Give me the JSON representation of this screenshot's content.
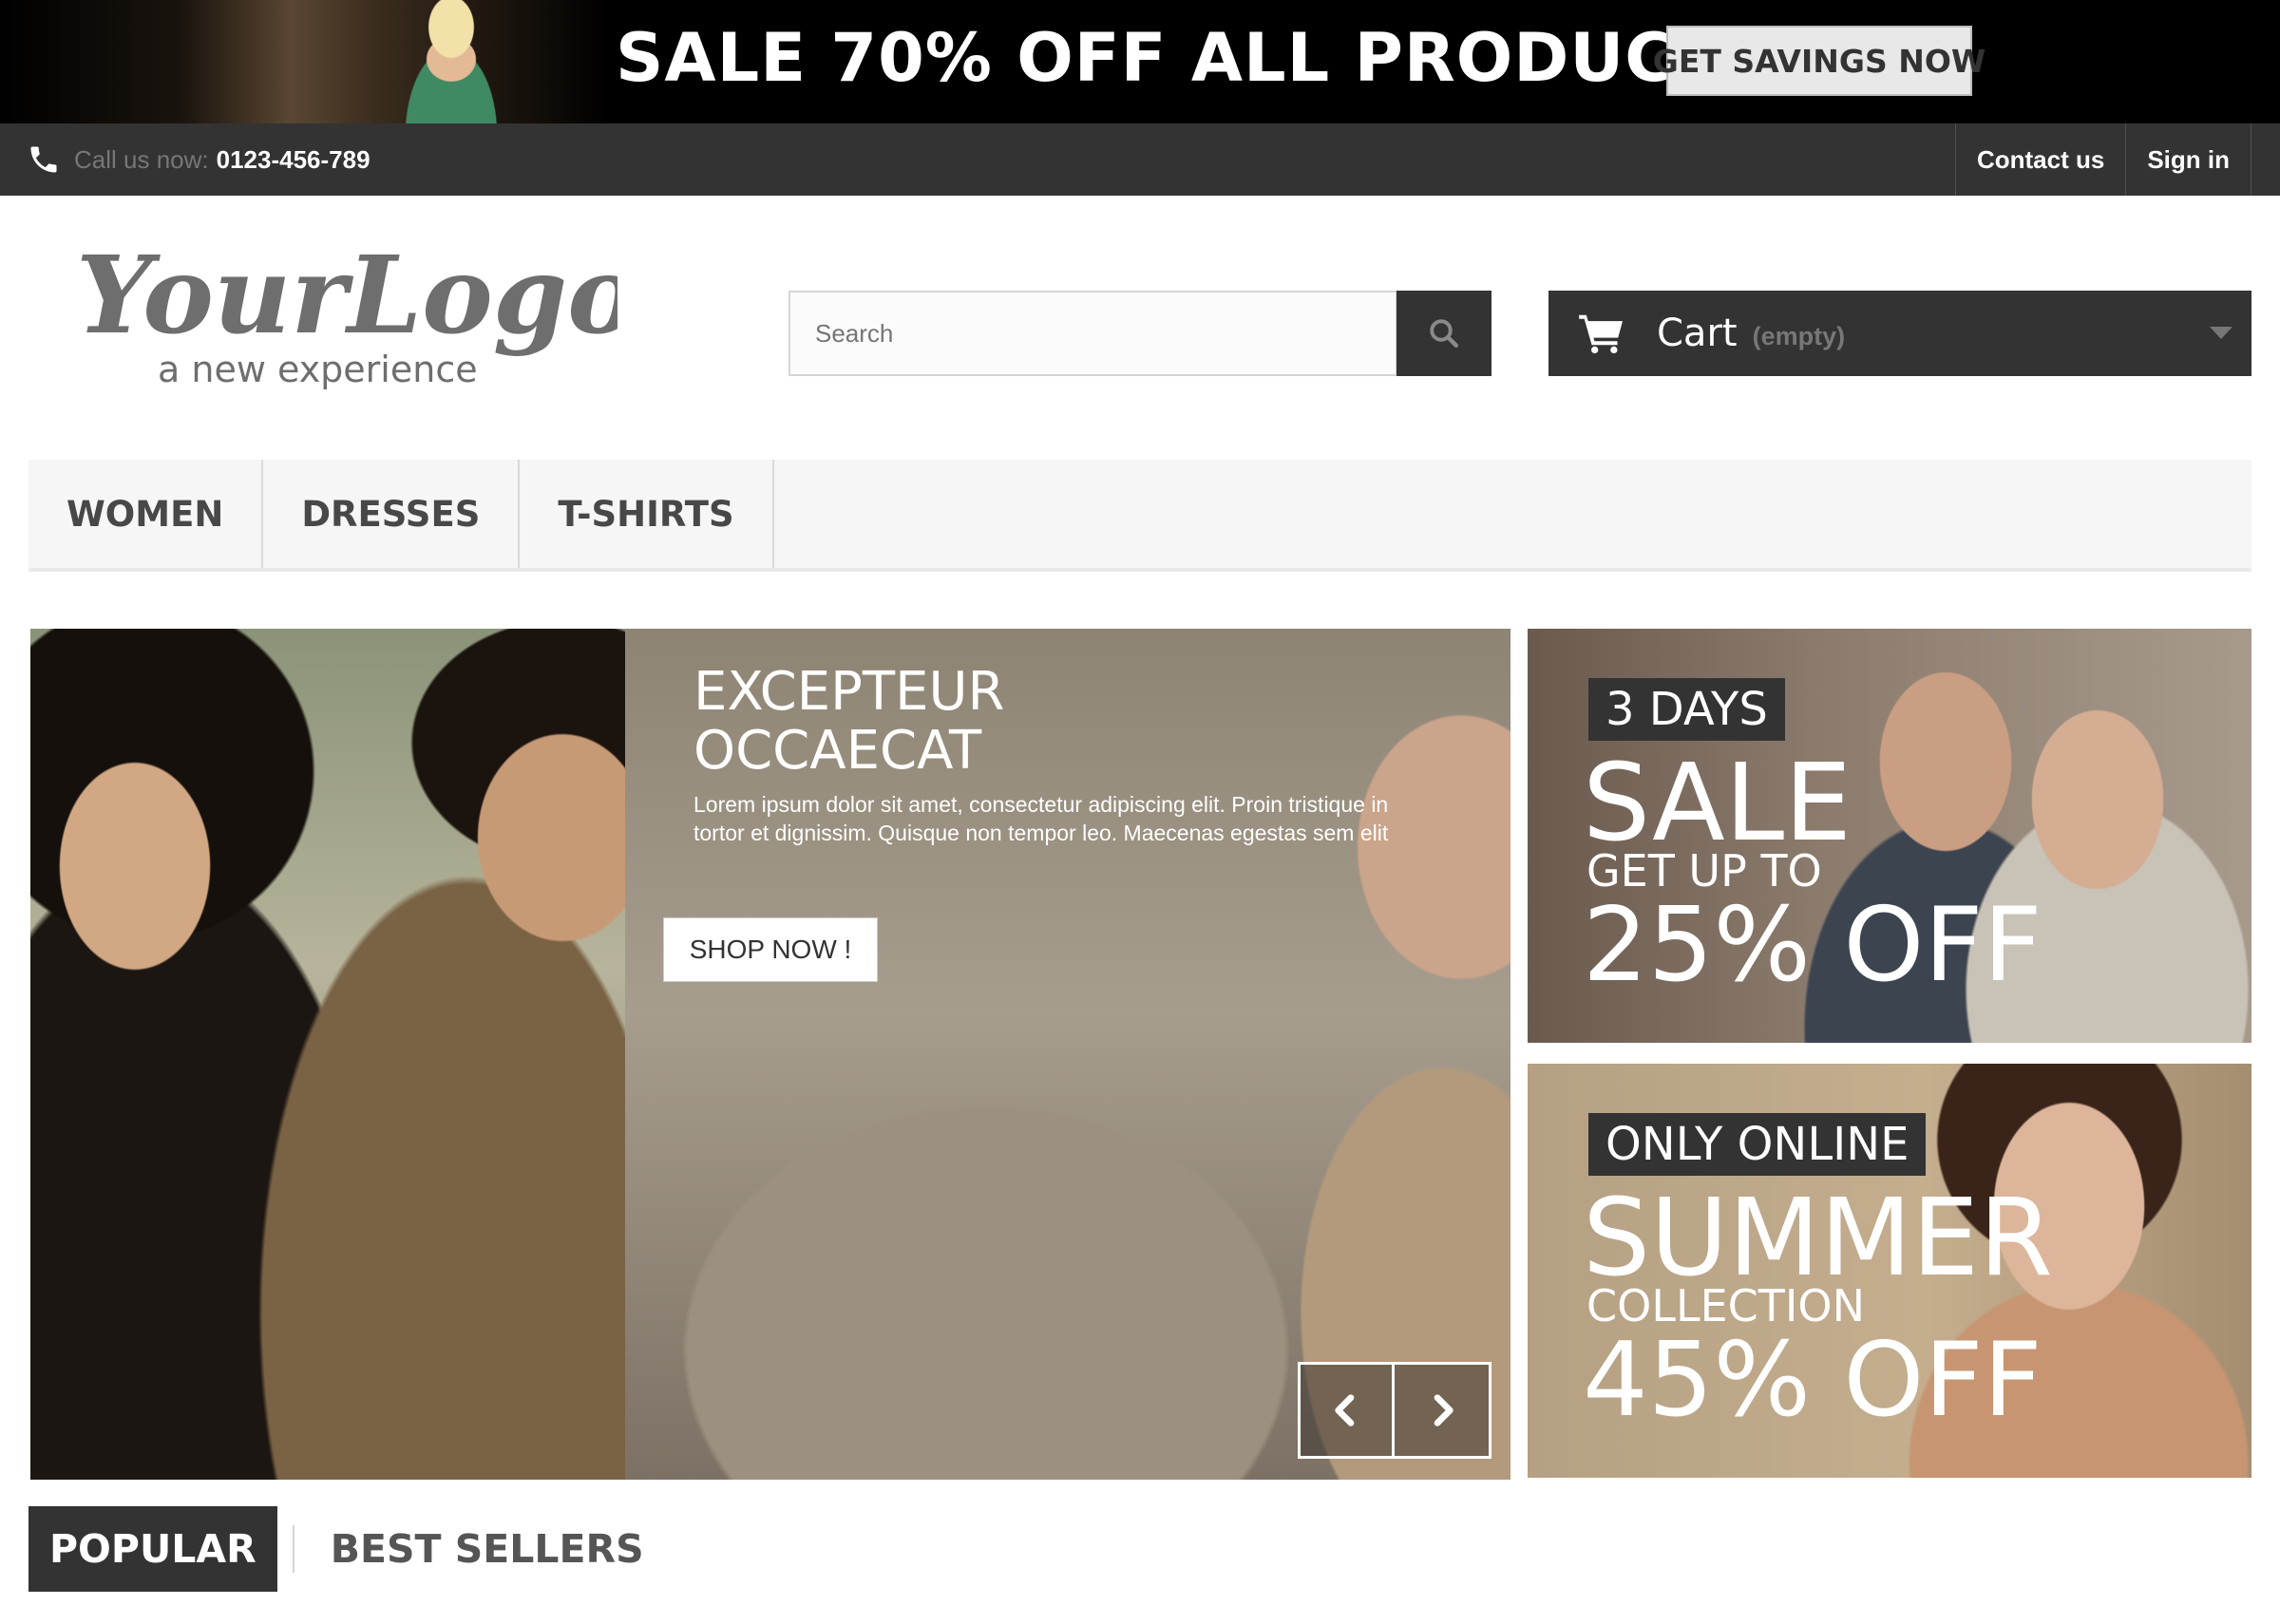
{
  "promo_banner": {
    "headline": "SALE 70% OFF ALL PRODUCTS",
    "button_label": "GET SAVINGS NOW"
  },
  "top_bar": {
    "call_label": "Call us now:",
    "phone_number": "0123-456-789",
    "links": [
      "Contact us",
      "Sign in"
    ]
  },
  "header": {
    "logo_text": "YourLogo",
    "logo_tagline": "a new experience",
    "search_placeholder": "Search",
    "cart_label": "Cart",
    "cart_status": "(empty)"
  },
  "menu": {
    "items": [
      "WOMEN",
      "DRESSES",
      "T-SHIRTS"
    ]
  },
  "slider": {
    "title_line1": "EXCEPTEUR",
    "title_line2": "OCCAECAT",
    "text": "Lorem ipsum dolor sit amet, consectetur adipiscing elit. Proin tristique in tortor et dignissim. Quisque non tempor leo. Maecenas egestas sem elit",
    "button_label": "SHOP NOW !"
  },
  "promo_tiles": [
    {
      "tag": "3 DAYS",
      "big": "SALE",
      "mid": "GET UP TO",
      "pct": "25% OFF"
    },
    {
      "tag": "ONLY ONLINE",
      "big": "SUMMER",
      "mid": "COLLECTION",
      "pct": "45% OFF"
    }
  ],
  "product_tabs": {
    "active": "POPULAR",
    "inactive": "BEST SELLERS"
  },
  "colors": {
    "dark": "#333333",
    "menu_bg": "#f6f6f6",
    "muted": "#777777"
  }
}
